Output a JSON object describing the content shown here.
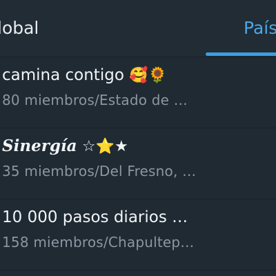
{
  "tabs": [
    {
      "label": "lobal",
      "selected": false
    },
    {
      "label": "País",
      "selected": true
    }
  ],
  "colors": {
    "background": "#1f2a33",
    "accent": "#3c9ee0",
    "title_text": "#f2f4f6",
    "subtitle_text": "#8b97a2"
  },
  "groups": [
    {
      "name": "camina contigo",
      "emoji": "🥰🌻",
      "subtitle": "80 miembros/Estado de …"
    },
    {
      "name": "Sinergía",
      "emoji": "☆⭐★",
      "subtitle": "35 miembros/Del Fresno, …"
    },
    {
      "name": "10 000 pasos diarios …",
      "emoji": "",
      "subtitle": "158 miembros/Chapultep…"
    }
  ]
}
